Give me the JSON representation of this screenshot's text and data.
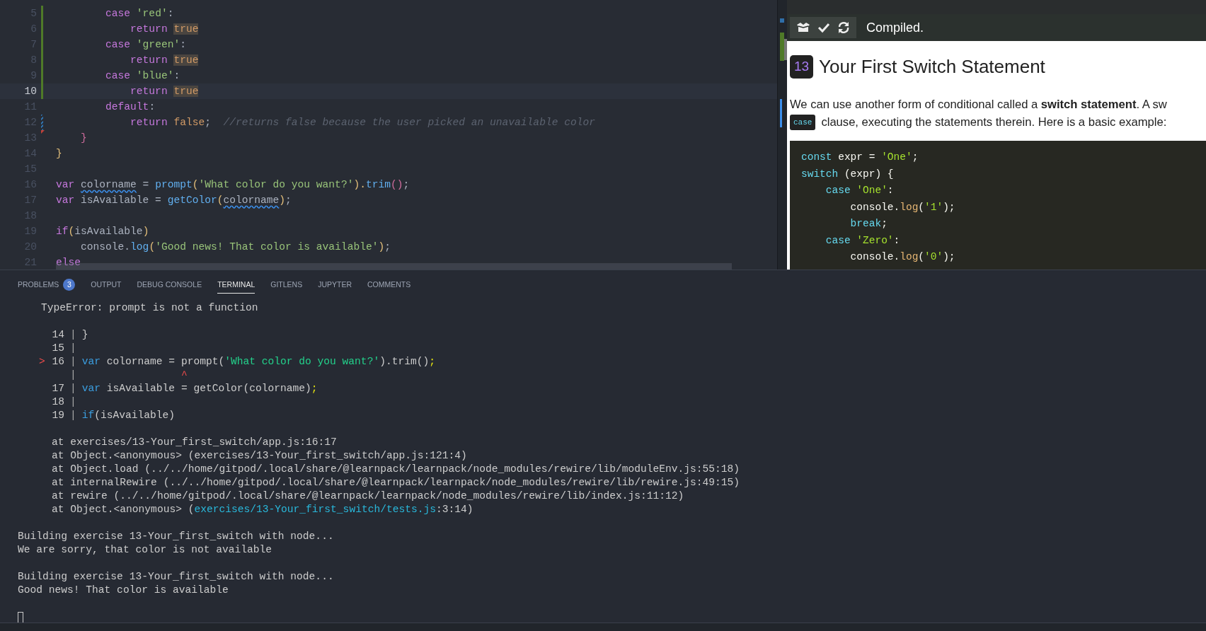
{
  "editor": {
    "lines": [
      {
        "number": "5",
        "kind": "added",
        "current": false,
        "tokens": [
          {
            "text": "        case ",
            "kind": "keyword"
          },
          {
            "text": "'red'",
            "kind": "string"
          },
          {
            "text": ":",
            "kind": "plain"
          }
        ]
      },
      {
        "number": "6",
        "kind": "added",
        "current": false,
        "tokens": [
          {
            "text": "            return ",
            "kind": "keyword"
          },
          {
            "text": "true",
            "kind": "bool-highlight"
          }
        ]
      },
      {
        "number": "7",
        "kind": "added",
        "current": false,
        "tokens": [
          {
            "text": "        case ",
            "kind": "keyword"
          },
          {
            "text": "'green'",
            "kind": "string"
          },
          {
            "text": ":",
            "kind": "plain"
          }
        ]
      },
      {
        "number": "8",
        "kind": "added",
        "current": false,
        "tokens": [
          {
            "text": "            return ",
            "kind": "keyword"
          },
          {
            "text": "true",
            "kind": "bool-highlight"
          }
        ]
      },
      {
        "number": "9",
        "kind": "added",
        "current": false,
        "tokens": [
          {
            "text": "        case ",
            "kind": "keyword"
          },
          {
            "text": "'blue'",
            "kind": "string"
          },
          {
            "text": ":",
            "kind": "plain"
          }
        ]
      },
      {
        "number": "10",
        "kind": "added",
        "current": true,
        "tokens": [
          {
            "text": "            return ",
            "kind": "keyword"
          },
          {
            "text": "true",
            "kind": "bool-highlight"
          }
        ]
      },
      {
        "number": "11",
        "kind": "unchanged",
        "current": false,
        "tokens": [
          {
            "text": "        default",
            "kind": "keyword"
          },
          {
            "text": ":",
            "kind": "plain"
          }
        ]
      },
      {
        "number": "12",
        "kind": "modified",
        "current": false,
        "tokens": [
          {
            "text": "            return ",
            "kind": "keyword"
          },
          {
            "text": "false",
            "kind": "bool"
          },
          {
            "text": ";  ",
            "kind": "plain"
          },
          {
            "text": "//returns false because the user picked an unavailable color",
            "kind": "comment"
          }
        ]
      },
      {
        "number": "13",
        "kind": "deleted",
        "current": false,
        "tokens": [
          {
            "text": "    }",
            "kind": "brace-inner"
          }
        ]
      },
      {
        "number": "14",
        "kind": "unchanged",
        "current": false,
        "tokens": [
          {
            "text": "}",
            "kind": "bracket"
          }
        ]
      },
      {
        "number": "15",
        "kind": "unchanged",
        "current": false
      },
      {
        "number": "16",
        "kind": "unchanged",
        "current": false,
        "tokens": [
          {
            "text": "var ",
            "kind": "keyword"
          },
          {
            "text": "colorname",
            "kind": "squiggle"
          },
          {
            "text": " = ",
            "kind": "plain"
          },
          {
            "text": "prompt",
            "kind": "function"
          },
          {
            "text": "(",
            "kind": "bracket"
          },
          {
            "text": "'What color do you want?'",
            "kind": "string"
          },
          {
            "text": ").",
            "kind": "bracket"
          },
          {
            "text": "trim",
            "kind": "function"
          },
          {
            "text": "()",
            "kind": "brace-inner"
          },
          {
            "text": ";",
            "kind": "plain"
          }
        ]
      },
      {
        "number": "17",
        "kind": "unchanged",
        "current": false,
        "tokens": [
          {
            "text": "var ",
            "kind": "keyword"
          },
          {
            "text": "isAvailable = ",
            "kind": "plain"
          },
          {
            "text": "getColor",
            "kind": "function"
          },
          {
            "text": "(",
            "kind": "bracket"
          },
          {
            "text": "colorname",
            "kind": "squiggle"
          },
          {
            "text": ")",
            "kind": "bracket"
          },
          {
            "text": ";",
            "kind": "plain"
          }
        ]
      },
      {
        "number": "18",
        "kind": "unchanged",
        "current": false
      },
      {
        "number": "19",
        "kind": "unchanged",
        "current": false,
        "tokens": [
          {
            "text": "if",
            "kind": "keyword"
          },
          {
            "text": "(",
            "kind": "bracket"
          },
          {
            "text": "isAvailable",
            "kind": "plain"
          },
          {
            "text": ")",
            "kind": "bracket"
          }
        ]
      },
      {
        "number": "20",
        "kind": "unchanged",
        "current": false,
        "tokens": [
          {
            "text": "    console.",
            "kind": "plain"
          },
          {
            "text": "log",
            "kind": "function"
          },
          {
            "text": "(",
            "kind": "bracket"
          },
          {
            "text": "'Good news! That color is available'",
            "kind": "string"
          },
          {
            "text": ")",
            "kind": "bracket"
          },
          {
            "text": ";",
            "kind": "plain"
          }
        ]
      },
      {
        "number": "21",
        "kind": "unchanged",
        "current": false,
        "tokens": [
          {
            "text": "else",
            "kind": "keyword"
          }
        ]
      }
    ]
  },
  "preview": {
    "toolbar": {
      "buttons": [
        {
          "kind": "package"
        },
        {
          "kind": "check"
        },
        {
          "kind": "refresh"
        }
      ],
      "status": "Compiled."
    },
    "badge": "13",
    "title": "Your First Switch Statement",
    "paragraph_line": "We can use another form of conditional called a **switch statement**. A sw",
    "inline_code": "case",
    "paragraph_rest": "clause, executing the statements therein. Here is a basic example:",
    "code": [
      [
        {
          "text": "const ",
          "kind": "keyword"
        },
        {
          "text": "expr = ",
          "kind": "plain"
        },
        {
          "text": "'One'",
          "kind": "string"
        },
        {
          "text": ";",
          "kind": "plain"
        }
      ],
      [
        {
          "text": "switch ",
          "kind": "keyword"
        },
        {
          "text": "(expr) {",
          "kind": "plain"
        }
      ],
      [
        {
          "text": "    case ",
          "kind": "keyword"
        },
        {
          "text": "'One'",
          "kind": "string"
        },
        {
          "text": ":",
          "kind": "plain"
        }
      ],
      [
        {
          "text": "        console.",
          "kind": "plain"
        },
        {
          "text": "log",
          "kind": "function"
        },
        {
          "text": "(",
          "kind": "plain"
        },
        {
          "text": "'1'",
          "kind": "string"
        },
        {
          "text": ");",
          "kind": "plain"
        }
      ],
      [
        {
          "text": "        break",
          "kind": "keyword"
        },
        {
          "text": ";",
          "kind": "plain"
        }
      ],
      [
        {
          "text": "    case ",
          "kind": "keyword"
        },
        {
          "text": "'Zero'",
          "kind": "string"
        },
        {
          "text": ":",
          "kind": "plain"
        }
      ],
      [
        {
          "text": "        console.",
          "kind": "plain"
        },
        {
          "text": "log",
          "kind": "function"
        },
        {
          "text": "(",
          "kind": "plain"
        },
        {
          "text": "'0'",
          "kind": "string"
        },
        {
          "text": ");",
          "kind": "plain"
        }
      ]
    ]
  },
  "panel": {
    "tabs": [
      {
        "label": "PROBLEMS",
        "count": "3",
        "selected": false
      },
      {
        "label": "OUTPUT",
        "selected": false
      },
      {
        "label": "DEBUG CONSOLE",
        "selected": false
      },
      {
        "label": "TERMINAL",
        "selected": true
      },
      {
        "label": "GITLENS",
        "selected": false
      },
      {
        "label": "JUPYTER",
        "selected": false
      },
      {
        "label": "COMMENTS",
        "selected": false
      }
    ],
    "terminal": [
      {
        "kind": "error",
        "text": "TypeError: prompt is not a function"
      },
      {
        "kind": "blank"
      },
      {
        "kind": "frame",
        "number": "14",
        "separator": "|",
        "tokens": [
          {
            "text": "}",
            "kind": "plain"
          }
        ]
      },
      {
        "kind": "frame",
        "number": "15",
        "separator": "|"
      },
      {
        "kind": "frame",
        "number": "16",
        "marker": ">",
        "separator": "|",
        "tokens": [
          {
            "text": "var ",
            "kind": "keyword"
          },
          {
            "text": "colorname = prompt(",
            "kind": "plain"
          },
          {
            "text": "'What color do you want?'",
            "kind": "string"
          },
          {
            "text": ").trim()",
            "kind": "plain"
          },
          {
            "text": ";",
            "kind": "semicolon"
          }
        ]
      },
      {
        "kind": "caret",
        "separator": "|",
        "text": "                ^"
      },
      {
        "kind": "frame",
        "number": "17",
        "separator": "|",
        "tokens": [
          {
            "text": "var ",
            "kind": "keyword"
          },
          {
            "text": "isAvailable = getColor(colorname)",
            "kind": "plain"
          },
          {
            "text": ";",
            "kind": "semicolon"
          }
        ]
      },
      {
        "kind": "frame",
        "number": "18",
        "separator": "|"
      },
      {
        "kind": "frame",
        "number": "19",
        "separator": "|",
        "tokens": [
          {
            "text": "if",
            "kind": "keyword"
          },
          {
            "text": "(isAvailable)",
            "kind": "plain"
          }
        ]
      },
      {
        "kind": "blank"
      },
      {
        "kind": "stack",
        "text": "at exercises/13-Your_first_switch/app.js:16:17"
      },
      {
        "kind": "stack",
        "text": "at Object.<anonymous> (exercises/13-Your_first_switch/app.js:121:4)"
      },
      {
        "kind": "stack",
        "text": "at Object.load (../../home/gitpod/.local/share/@learnpack/learnpack/node_modules/rewire/lib/moduleEnv.js:55:18)"
      },
      {
        "kind": "stack",
        "text": "at internalRewire (../../home/gitpod/.local/share/@learnpack/learnpack/node_modules/rewire/lib/rewire.js:49:15)"
      },
      {
        "kind": "stack",
        "text": "at rewire (../../home/gitpod/.local/share/@learnpack/learnpack/node_modules/rewire/lib/index.js:11:12)"
      },
      {
        "kind": "stack",
        "text": "at Object.<anonymous> (",
        "link": "exercises/13-Your_first_switch/tests.js",
        "after": ":3:14)"
      },
      {
        "kind": "blank"
      },
      {
        "kind": "output",
        "text": "Building exercise 13-Your_first_switch with node..."
      },
      {
        "kind": "output",
        "text": "We are sorry, that color is not available"
      },
      {
        "kind": "blank"
      },
      {
        "kind": "output",
        "text": "Building exercise 13-Your_first_switch with node..."
      },
      {
        "kind": "output",
        "text": "Good news! That color is available"
      },
      {
        "kind": "blank"
      },
      {
        "kind": "cursor"
      }
    ]
  }
}
